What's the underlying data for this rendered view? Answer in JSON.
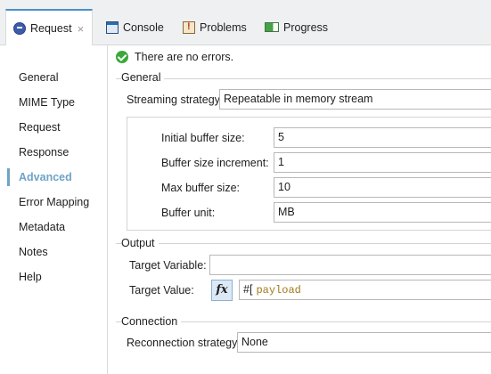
{
  "tabs": [
    {
      "label": "Request",
      "icon": "request-icon",
      "active": true,
      "closable": true
    },
    {
      "label": "Console",
      "icon": "console-icon"
    },
    {
      "label": "Problems",
      "icon": "problems-icon"
    },
    {
      "label": "Progress",
      "icon": "progress-icon"
    }
  ],
  "tab_close_glyph": "×",
  "sidebar": {
    "items": [
      {
        "label": "General"
      },
      {
        "label": "MIME Type"
      },
      {
        "label": "Request"
      },
      {
        "label": "Response"
      },
      {
        "label": "Advanced",
        "active": true
      },
      {
        "label": "Error Mapping"
      },
      {
        "label": "Metadata"
      },
      {
        "label": "Notes"
      },
      {
        "label": "Help"
      }
    ]
  },
  "status": {
    "text": "There are no errors.",
    "icon": "check-circle-icon"
  },
  "general": {
    "title": "General",
    "streaming_label": "Streaming strategy",
    "streaming_value": "Repeatable in memory stream",
    "initial_buffer_label": "Initial buffer size:",
    "initial_buffer_value": "5",
    "increment_label": "Buffer size increment:",
    "increment_value": "1",
    "max_buffer_label": "Max buffer size:",
    "max_buffer_value": "10",
    "unit_label": "Buffer unit:",
    "unit_value": "MB"
  },
  "output": {
    "title": "Output",
    "target_variable_label": "Target Variable:",
    "target_variable_value": "",
    "target_value_label": "Target Value:",
    "fx_label": "fx",
    "expr_prefix": "#[",
    "expr_value": "payload"
  },
  "connection": {
    "title": "Connection",
    "reconnection_label": "Reconnection strategy",
    "reconnection_value": "None"
  },
  "colors": {
    "accent": "#6fa3c8",
    "tab_border": "#4a90c8",
    "ok": "#3aa83a",
    "expr": "#a07a1a"
  }
}
